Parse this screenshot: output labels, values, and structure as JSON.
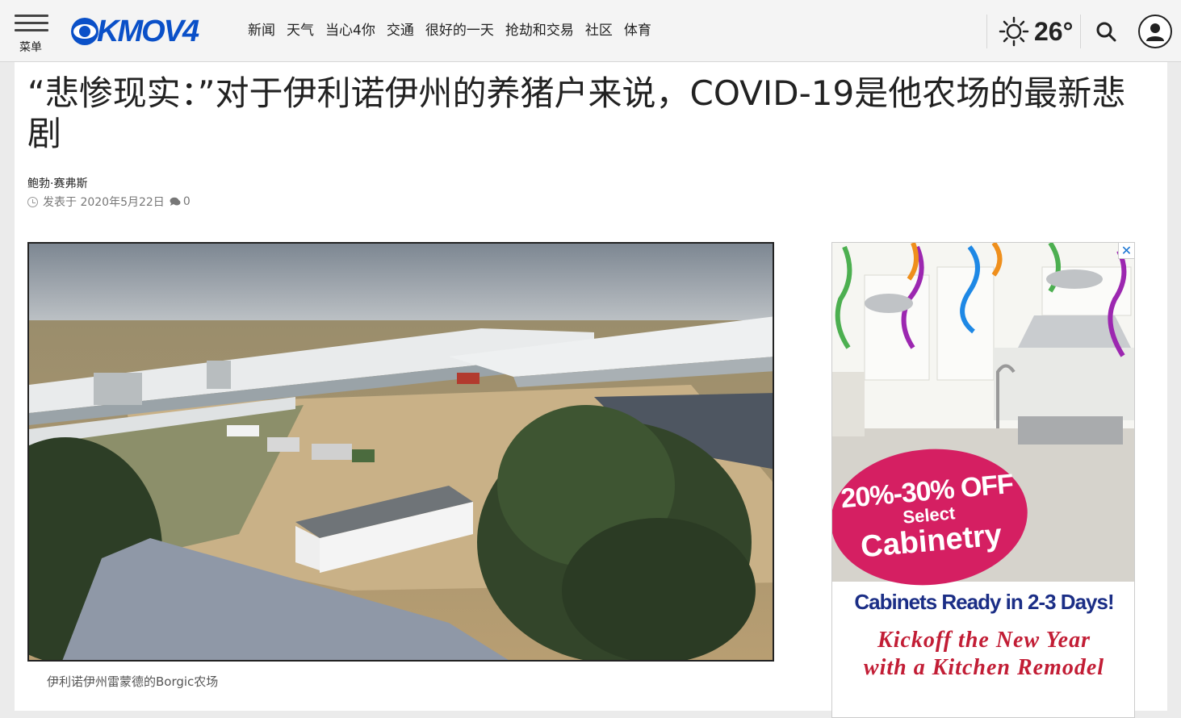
{
  "header": {
    "menu_label": "菜单",
    "logo_text": "KMOV4",
    "nav": [
      "新闻",
      "天气",
      "当心4你",
      "交通",
      "很好的一天",
      "抢劫和交易",
      "社区",
      "体育"
    ],
    "weather": {
      "temperature": "26°",
      "icon": "sun-icon"
    },
    "search_icon": "search-icon",
    "user_icon": "user-icon"
  },
  "article": {
    "headline": "“悲惨现实：”对于伊利诺伊州的养猪户来说，COVID-19是他农场的最新悲剧",
    "author": "鲍勃·赛弗斯",
    "published": "发表于 2020年5月22日",
    "comment_count": "0",
    "image_caption": "伊利诺伊州雷蒙德的Borgic农场"
  },
  "ad": {
    "close_label": "✕",
    "discount": "20%-30% OFF",
    "select": "Select",
    "cabinetry": "Cabinetry",
    "ready": "Cabinets Ready in 2-3 Days!",
    "kickoff_line1": "Kickoff the New Year",
    "kickoff_line2": "with a Kitchen Remodel"
  },
  "colors": {
    "brand_blue": "#0a50c8",
    "ad_pink": "#d51f62",
    "ad_navy": "#1b2e86",
    "ad_red": "#c21d35"
  }
}
